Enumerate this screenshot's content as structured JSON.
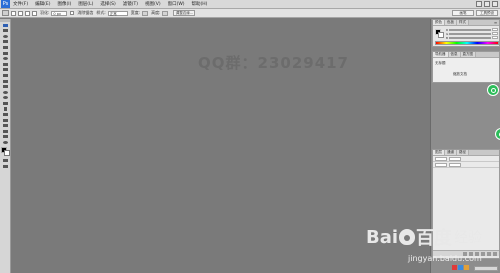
{
  "app": {
    "logo_text": "Ps"
  },
  "menubar": {
    "items": [
      "文件(F)",
      "编辑(E)",
      "图像(I)",
      "图层(L)",
      "选择(S)",
      "滤镜(T)",
      "视图(V)",
      "窗口(W)",
      "帮助(H)"
    ]
  },
  "options": {
    "feather_label": "羽化:",
    "feather_value": "0 px",
    "antialias_label": "消除锯齿",
    "style_label": "样式:",
    "style_value": "正常",
    "width_label": "宽度:",
    "height_label": "高度:",
    "refine_label": "调整边缘...",
    "wells": [
      "画笔",
      "工具预设"
    ]
  },
  "dock": {
    "color_panel": {
      "tabs": [
        "颜色",
        "色板",
        "样式"
      ],
      "menu_icon": "menu-icon"
    },
    "styles_panel": {
      "tabs": [
        "导航器",
        "信息",
        "直方图"
      ],
      "items": [
        "无标题",
        "缩放文档"
      ]
    },
    "layers_panel": {
      "tabs": [
        "图层",
        "通道",
        "路径"
      ]
    }
  },
  "watermark": {
    "text": "QQ群：23029417"
  },
  "baidu": {
    "bai": "Bai",
    "du": "百度",
    "jingyan": "经验",
    "url": "jingyan.baidu.com"
  },
  "status": {
    "text": ""
  },
  "colors": {
    "workspace": "#7a7a7a",
    "accent": "#2dbd5a",
    "brand": "#2b6fd6"
  }
}
